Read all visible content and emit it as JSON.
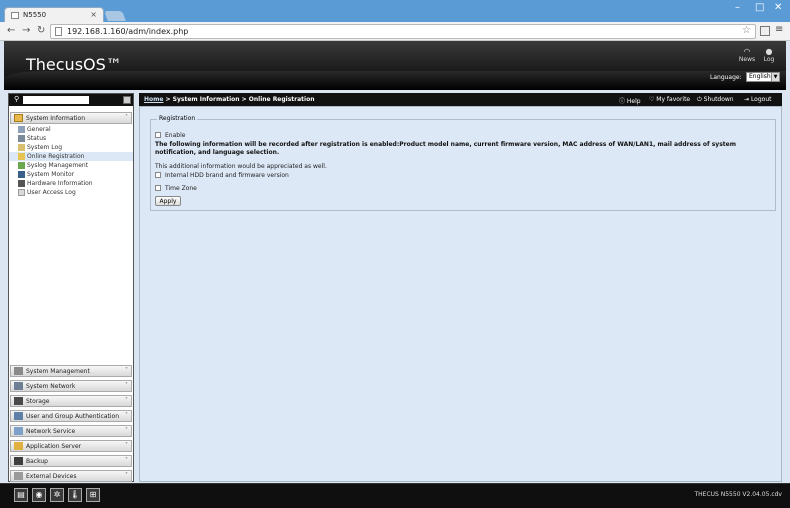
{
  "browser": {
    "tab_title": "N5550",
    "url": "192.168.1.160/adm/index.php"
  },
  "header": {
    "logo": "ThecusOS™",
    "news_label": "News",
    "log_label": "Log",
    "language_label": "Language:",
    "language_value": "English"
  },
  "sidebar": {
    "search_placeholder": "",
    "categories": [
      {
        "label": "System Information",
        "expanded": true
      },
      {
        "label": "System Management"
      },
      {
        "label": "System Network"
      },
      {
        "label": "Storage"
      },
      {
        "label": "User and Group Authentication"
      },
      {
        "label": "Network Service"
      },
      {
        "label": "Application Server"
      },
      {
        "label": "Backup"
      },
      {
        "label": "External Devices"
      }
    ],
    "items": [
      {
        "label": "General"
      },
      {
        "label": "Status"
      },
      {
        "label": "System Log"
      },
      {
        "label": "Online Registration"
      },
      {
        "label": "Syslog Management"
      },
      {
        "label": "System Monitor"
      },
      {
        "label": "Hardware Information"
      },
      {
        "label": "User Access Log"
      }
    ]
  },
  "crumbbar": {
    "home": "Home",
    "path": " > System Information > Online Registration",
    "help": "Help",
    "favorite": "My favorite",
    "shutdown": "Shutdown",
    "logout": "Logout"
  },
  "registration": {
    "legend": "Registration",
    "enable_label": "Enable",
    "info_text": "The following information will be recorded after registration is enabled:Product model name, current firmware version, MAC address of WAN/LAN1, mail address of system notification, and language selection.",
    "additional_text": "This additional information would be appreciated as well.",
    "hdd_label": "Internal HDD brand and firmware version",
    "timezone_label": "Time Zone",
    "apply_label": "Apply"
  },
  "footer": {
    "version": "THECUS N5550 V2.04.05.cdv"
  },
  "colors": {
    "content_bg": "#dce8f6",
    "header_bg": "#1c1c1c",
    "browser_accent": "#5b9bd5"
  }
}
